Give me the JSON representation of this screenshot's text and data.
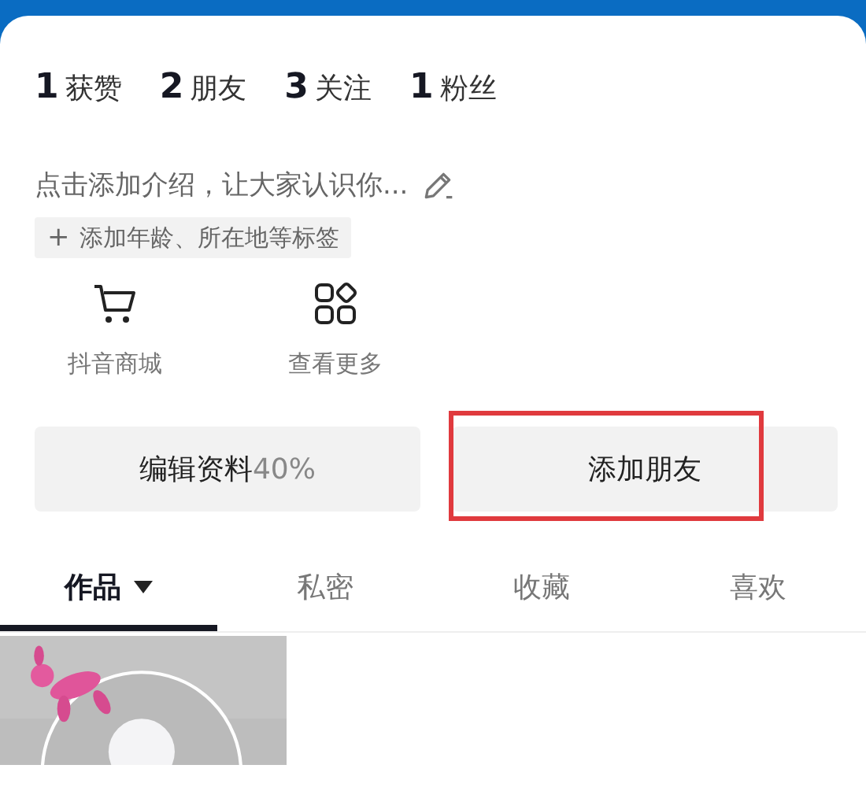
{
  "stats": [
    {
      "count": "1",
      "label": "获赞"
    },
    {
      "count": "2",
      "label": "朋友"
    },
    {
      "count": "3",
      "label": "关注"
    },
    {
      "count": "1",
      "label": "粉丝"
    }
  ],
  "bio": {
    "placeholder": "点击添加介绍，让大家认识你..."
  },
  "tag_button": {
    "icon": "+",
    "label": "添加年龄、所在地等标签"
  },
  "shortcuts": [
    {
      "kind": "cart",
      "label": "抖音商城"
    },
    {
      "kind": "grid",
      "label": "查看更多"
    }
  ],
  "buttons": [
    {
      "label": "编辑资料",
      "percent": "40%",
      "highlighted": false
    },
    {
      "label": "添加朋友",
      "highlighted": true
    }
  ],
  "tabs": [
    {
      "label": "作品",
      "selected": true,
      "dropdown": true
    },
    {
      "label": "私密",
      "selected": false
    },
    {
      "label": "收藏",
      "selected": false
    },
    {
      "label": "喜欢",
      "selected": false
    }
  ]
}
